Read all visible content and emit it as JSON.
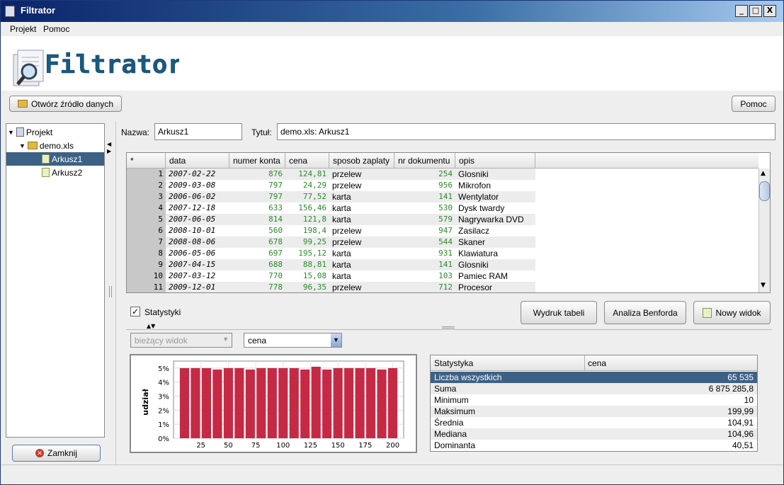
{
  "window": {
    "title": "Filtrator",
    "min": "_",
    "max": "□",
    "close": "X"
  },
  "menu": [
    "Projekt",
    "Pomoc"
  ],
  "logo_text": "Filtrator",
  "toolbar": {
    "open_label": "Otwórz źródło danych",
    "help_label": "Pomoc"
  },
  "tree": {
    "root": "Projekt",
    "file": "demo.xls",
    "sheets": [
      "Arkusz1",
      "Arkusz2"
    ],
    "selected": "Arkusz1"
  },
  "close_button": "Zamknij",
  "form": {
    "name_label": "Nazwa:",
    "name_value": "Arkusz1",
    "title_label": "Tytuł:",
    "title_value": "demo.xls: Arkusz1"
  },
  "table": {
    "columns": [
      "*",
      "data",
      "numer konta",
      "cena",
      "sposob zaplaty",
      "nr dokumentu",
      "opis"
    ],
    "rows": [
      [
        "1",
        "2007-02-22",
        "876",
        "124,81",
        "przelew",
        "254",
        "Glosniki"
      ],
      [
        "2",
        "2009-03-08",
        "797",
        "24,29",
        "przelew",
        "956",
        "Mikrofon"
      ],
      [
        "3",
        "2006-06-02",
        "797",
        "77,52",
        "karta",
        "141",
        "Wentylator"
      ],
      [
        "4",
        "2007-12-18",
        "633",
        "156,46",
        "karta",
        "530",
        "Dysk twardy"
      ],
      [
        "5",
        "2007-06-05",
        "814",
        "121,8",
        "karta",
        "579",
        "Nagrywarka DVD"
      ],
      [
        "6",
        "2008-10-01",
        "560",
        "198,4",
        "przelew",
        "947",
        "Zasilacz"
      ],
      [
        "7",
        "2008-08-06",
        "678",
        "99,25",
        "przelew",
        "544",
        "Skaner"
      ],
      [
        "8",
        "2006-05-06",
        "697",
        "195,12",
        "karta",
        "931",
        "Klawiatura"
      ],
      [
        "9",
        "2007-04-15",
        "688",
        "88,81",
        "karta",
        "141",
        "Glosniki"
      ],
      [
        "10",
        "2007-03-12",
        "770",
        "15,08",
        "karta",
        "103",
        "Pamiec RAM"
      ],
      [
        "11",
        "2009-12-01",
        "778",
        "96,35",
        "przelew",
        "712",
        "Procesor"
      ]
    ]
  },
  "checkbox": {
    "label": "Statystyki",
    "checked": true
  },
  "actions": {
    "print": "Wydruk tabeli",
    "benford": "Analiza Benforda",
    "new_view": "Nowy widok"
  },
  "view_combo": "bieżący widok",
  "column_combo": "cena",
  "stats": {
    "headers": [
      "Statystyka",
      "cena"
    ],
    "rows": [
      [
        "Liczba wszystkich",
        "65 535"
      ],
      [
        "Suma",
        "6 875 285,8"
      ],
      [
        "Minimum",
        "10"
      ],
      [
        "Maksimum",
        "199,99"
      ],
      [
        "Średnia",
        "104,91"
      ],
      [
        "Mediana",
        "104,96"
      ],
      [
        "Dominanta",
        "40,51"
      ]
    ]
  },
  "chart_data": {
    "type": "bar",
    "title": "",
    "xlabel": "",
    "ylabel": "udział",
    "bar_color": "#c52a45",
    "x": [
      10,
      20,
      30,
      40,
      50,
      60,
      70,
      80,
      90,
      100,
      110,
      120,
      130,
      140,
      150,
      160,
      170,
      180,
      190,
      200
    ],
    "values": [
      5.0,
      5.0,
      5.0,
      4.9,
      5.0,
      5.0,
      4.9,
      5.0,
      5.0,
      5.0,
      5.0,
      4.9,
      5.1,
      4.9,
      5.0,
      5.0,
      5.0,
      5.0,
      4.9,
      5.0
    ],
    "xticks": [
      "25",
      "50",
      "75",
      "100",
      "125",
      "150",
      "175",
      "200"
    ],
    "yticks": [
      "0%",
      "1%",
      "2%",
      "3%",
      "4%",
      "5%"
    ],
    "ylim": [
      0,
      5.5
    ],
    "grid": true
  }
}
